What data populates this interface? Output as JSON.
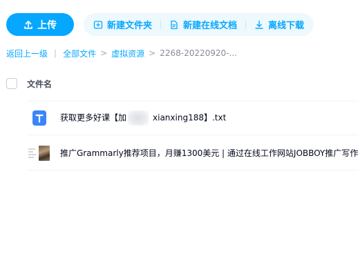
{
  "toolbar": {
    "upload_label": "上传",
    "actions": [
      {
        "label": "新建文件夹",
        "icon": "new-folder-icon"
      },
      {
        "label": "新建在线文档",
        "icon": "new-doc-icon"
      },
      {
        "label": "离线下载",
        "icon": "download-icon"
      }
    ]
  },
  "breadcrumb": {
    "back": "返回上一级",
    "items": [
      "全部文件",
      "虚拟资源"
    ],
    "current": "2268-20220920-..."
  },
  "file_list": {
    "column_title": "文件名",
    "files": [
      {
        "name_prefix": "获取更多好课【加",
        "name_suffix": "xianxing188】.txt",
        "type": "txt"
      },
      {
        "name": "推广Grammarly推荐项目，月赚1300美元 | 通过在线工作网站JOBBOY推广写作",
        "type": "video"
      }
    ]
  },
  "colors": {
    "accent": "#06a7ff",
    "action_bg": "#eef9fe"
  }
}
